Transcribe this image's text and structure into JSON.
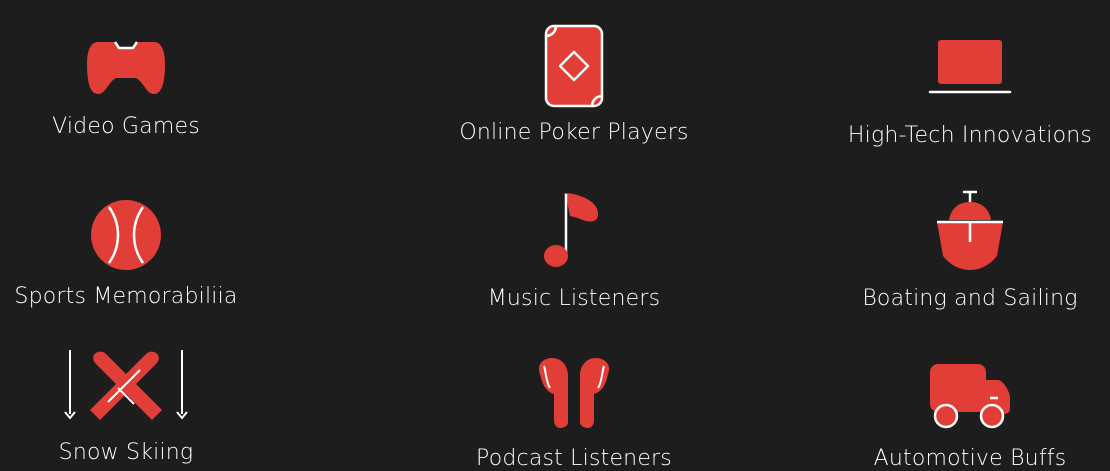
{
  "colors": {
    "background": "#1d1d1d",
    "icon_fill": "#e03e36",
    "icon_stroke": "#ffffff",
    "label_text": "#ffffff"
  },
  "interests": [
    {
      "label": "Video Games",
      "icon": "game-controller-icon"
    },
    {
      "label": "Online Poker Players",
      "icon": "playing-card-icon"
    },
    {
      "label": "High-Tech Innovations",
      "icon": "laptop-icon"
    },
    {
      "label": "Sports Memorabiliia",
      "icon": "baseball-icon"
    },
    {
      "label": "Music Listeners",
      "icon": "music-note-icon"
    },
    {
      "label": "Boating and Sailing",
      "icon": "boat-icon"
    },
    {
      "label": "Snow Skiing",
      "icon": "skis-icon"
    },
    {
      "label": "Podcast Listeners",
      "icon": "earbuds-icon"
    },
    {
      "label": "Automotive Buffs",
      "icon": "truck-icon"
    }
  ]
}
